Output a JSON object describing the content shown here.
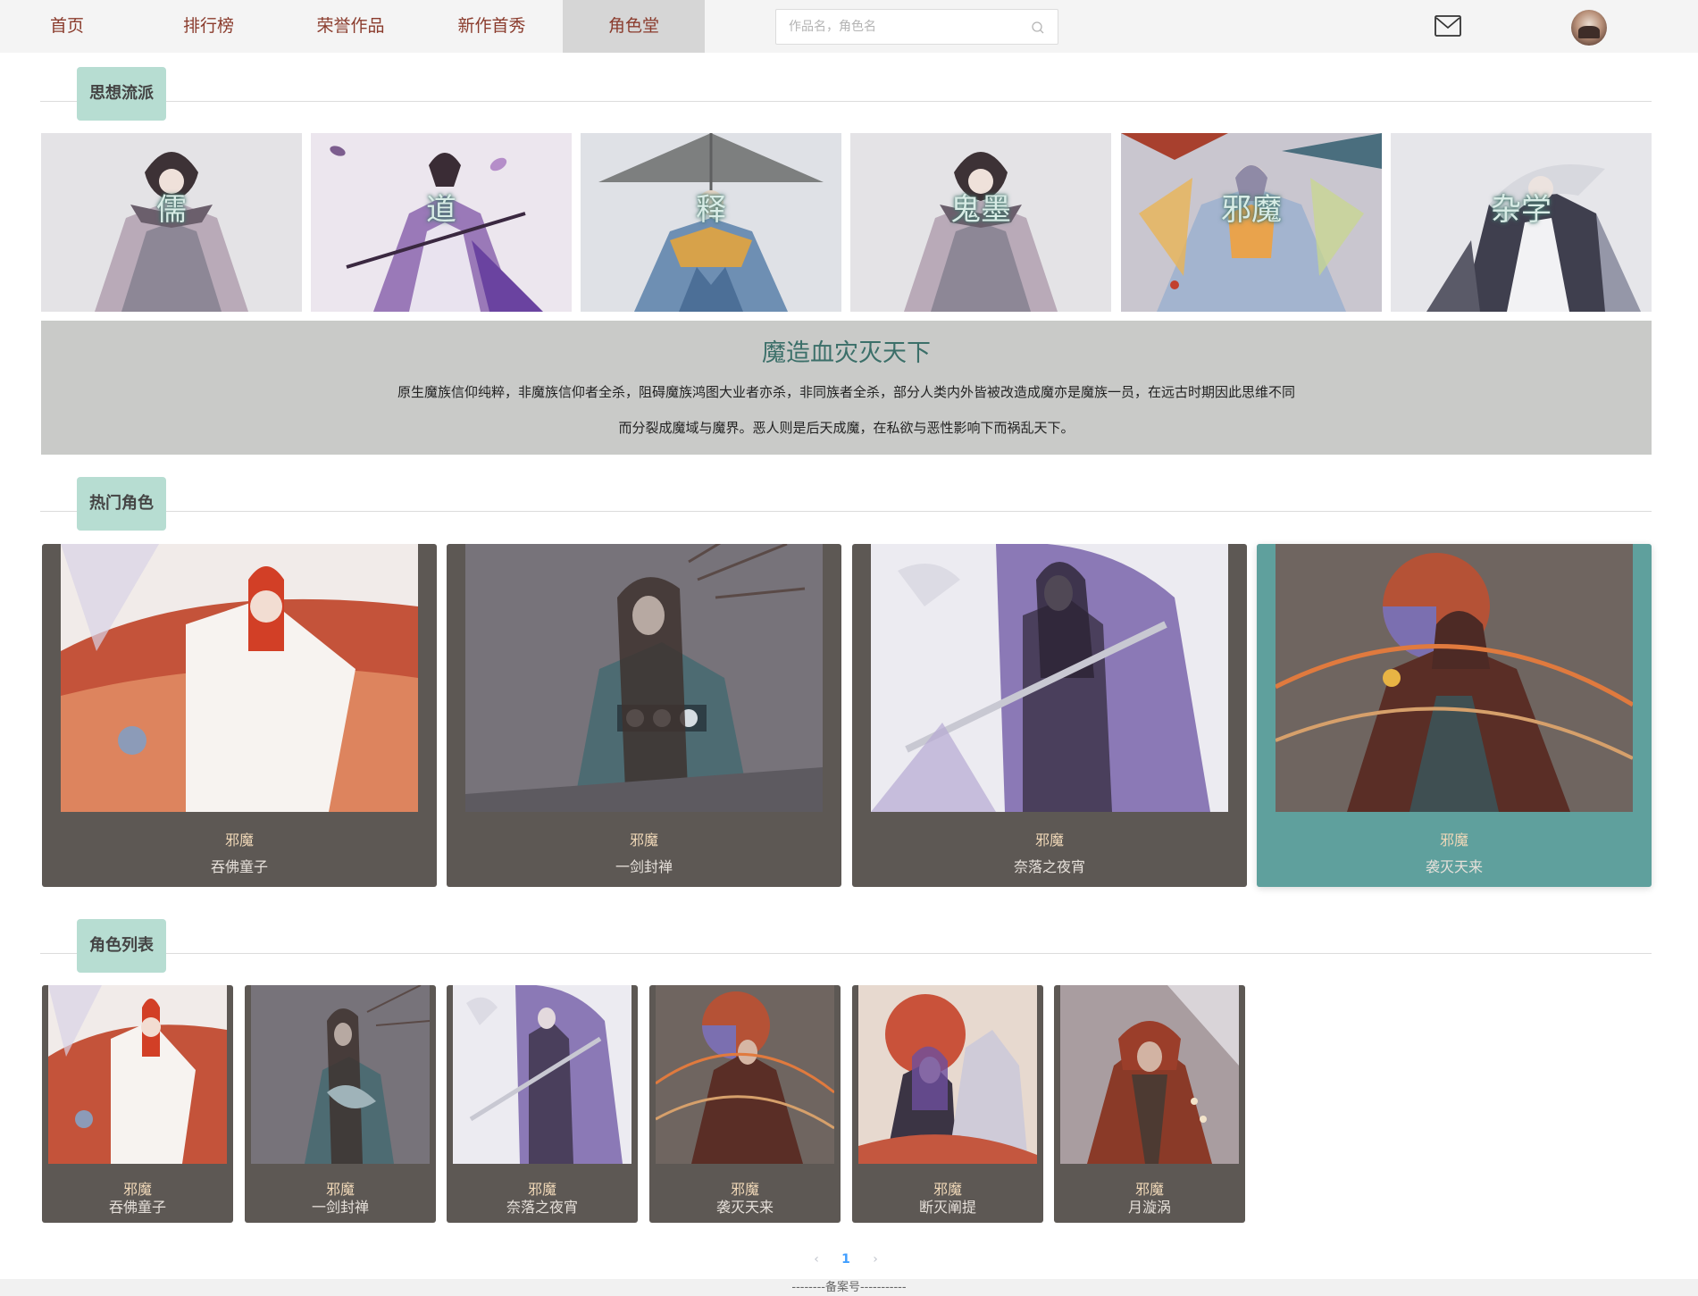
{
  "nav": {
    "items": [
      {
        "label": "首页"
      },
      {
        "label": "排行榜"
      },
      {
        "label": "荣誉作品"
      },
      {
        "label": "新作首秀"
      },
      {
        "label": "角色堂"
      }
    ],
    "active_index": 4,
    "search_placeholder": "作品名，角色名"
  },
  "sections": {
    "schools_title": "思想流派",
    "hot_title": "热门角色",
    "list_title": "角色列表"
  },
  "schools": [
    {
      "label": "儒"
    },
    {
      "label": "道"
    },
    {
      "label": "释"
    },
    {
      "label": "鬼墨"
    },
    {
      "label": "邪魔"
    },
    {
      "label": "杂学"
    }
  ],
  "school_detail": {
    "title": "魔造血灾灭天下",
    "line1": "原生魔族信仰纯粹，非魔族信仰者全杀，阻碍魔族鸿图大业者亦杀，非同族者全杀，部分人类内外皆被改造成魔亦是魔族一员，在远古时期因此思维不同",
    "line2": "而分裂成魔域与魔界。恶人则是后天成魔，在私欲与恶性影响下而祸乱天下。"
  },
  "hot_roles": [
    {
      "school": "邪魔",
      "name": "吞佛童子"
    },
    {
      "school": "邪魔",
      "name": "一剑封禅"
    },
    {
      "school": "邪魔",
      "name": "奈落之夜宵"
    },
    {
      "school": "邪魔",
      "name": "袭灭天来"
    }
  ],
  "role_list": [
    {
      "school": "邪魔",
      "name": "吞佛童子"
    },
    {
      "school": "邪魔",
      "name": "一剑封禅"
    },
    {
      "school": "邪魔",
      "name": "奈落之夜宵"
    },
    {
      "school": "邪魔",
      "name": "袭灭天来"
    },
    {
      "school": "邪魔",
      "name": "断灭阐提"
    },
    {
      "school": "邪魔",
      "name": "月漩涡"
    }
  ],
  "pagination": {
    "prev": "‹",
    "current": "1",
    "next": "›"
  },
  "footer": {
    "text": "--------备案号-----------"
  },
  "colors": {
    "nav_text": "#8a3b2c",
    "badge_bg": "#b7ddd2",
    "card_bg": "#5d5854",
    "card_highlight": "#5fa09d",
    "desc_bg": "#c9cac8",
    "desc_title": "#3b6f69"
  },
  "icons": {
    "search": "search-icon",
    "mail": "mail-icon",
    "avatar": "avatar"
  }
}
